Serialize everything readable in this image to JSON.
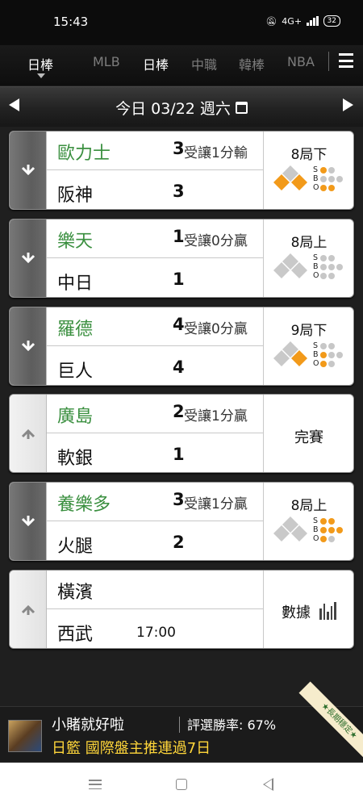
{
  "status_bar": {
    "time": "15:43",
    "network": "4G+",
    "battery": "32"
  },
  "tabs": [
    {
      "label": "日棒",
      "active": true
    },
    {
      "label": "MLB",
      "active": false
    },
    {
      "label": "日棒",
      "active": false
    },
    {
      "label": "中職",
      "active": false
    },
    {
      "label": "韓棒",
      "active": false
    },
    {
      "label": "NBA",
      "active": false
    }
  ],
  "date_bar": {
    "label": "今日 03/22 週六"
  },
  "games": [
    {
      "away_team": "歐力士",
      "away_score": "3",
      "odds": "受讓1分輸",
      "home_team": "阪神",
      "home_score": "3",
      "status": "8局下",
      "live": true,
      "bases": [
        true,
        false,
        true
      ],
      "balls": 0,
      "strikes": 1,
      "outs": 2
    },
    {
      "away_team": "樂天",
      "away_score": "1",
      "odds": "受讓0分贏",
      "home_team": "中日",
      "home_score": "1",
      "status": "8局上",
      "live": true,
      "bases": [
        false,
        false,
        false
      ],
      "balls": 0,
      "strikes": 0,
      "outs": 0
    },
    {
      "away_team": "羅德",
      "away_score": "4",
      "odds": "受讓0分贏",
      "home_team": "巨人",
      "home_score": "4",
      "status": "9局下",
      "live": true,
      "bases": [
        true,
        false,
        false
      ],
      "balls": 1,
      "strikes": 0,
      "outs": 1
    },
    {
      "away_team": "廣島",
      "away_score": "2",
      "odds": "受讓1分贏",
      "home_team": "軟銀",
      "home_score": "1",
      "status": "完賽",
      "live": false
    },
    {
      "away_team": "養樂多",
      "away_score": "3",
      "odds": "受讓1分贏",
      "home_team": "火腿",
      "home_score": "2",
      "status": "8局上",
      "live": true,
      "bases": [
        false,
        false,
        false
      ],
      "balls": 3,
      "strikes": 2,
      "outs": 1
    },
    {
      "away_team": "橫濱",
      "away_score": "",
      "odds": "",
      "home_team": "西武",
      "home_score": "",
      "start_time": "17:00",
      "status": "數據",
      "live": false,
      "upcoming": true
    }
  ],
  "sbo_labels": {
    "s": "S",
    "b": "B",
    "o": "O"
  },
  "ad": {
    "name": "小賭就好啦",
    "rate": "評選勝率: 67%",
    "tip": "日籃 國際盤主推連過7日",
    "ribbon": "★長期穩定★"
  },
  "colors": {
    "accent_orange": "#f29a1a",
    "away_green": "#3a8f3f",
    "tip_yellow": "#ffd63a"
  }
}
